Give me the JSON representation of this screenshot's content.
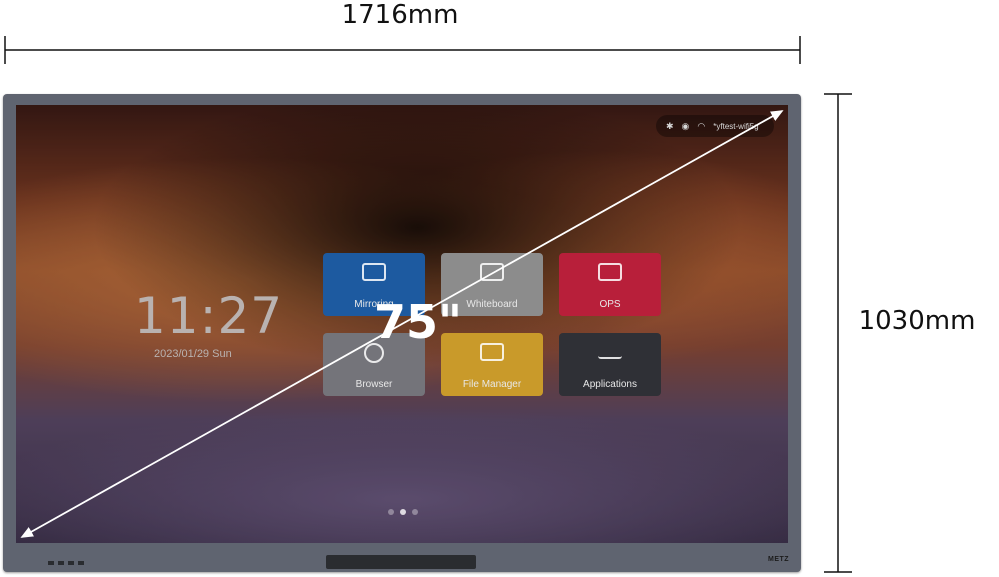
{
  "dimensions": {
    "width": "1716mm",
    "height": "1030mm",
    "diagonal": "75\""
  },
  "screen": {
    "status": {
      "bluetooth_icon": "bluetooth-icon",
      "signal_icon": "hotspot-icon",
      "wifi_icon": "wifi-icon",
      "network_name": "*yftest-wifi5g"
    },
    "clock": "11:27",
    "date": "2023/01/29  Sun",
    "tiles": [
      {
        "label": "Mirroring",
        "color": "#1d5aa0"
      },
      {
        "label": "Whiteboard",
        "color": "#8c8c8c"
      },
      {
        "label": "OPS",
        "color": "#b81f3a"
      },
      {
        "label": "Browser",
        "color": "#74747a"
      },
      {
        "label": "File Manager",
        "color": "#c99a2a"
      },
      {
        "label": "Applications",
        "color": "#2f3036"
      }
    ],
    "page_indicator": {
      "pages": 3,
      "active": 2
    }
  },
  "bezel": {
    "brand": "METZ"
  }
}
